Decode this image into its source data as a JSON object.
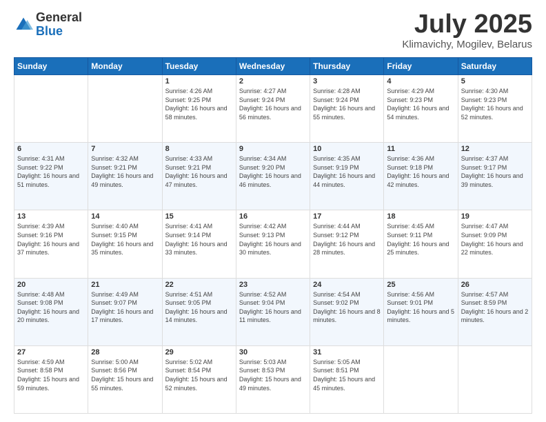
{
  "header": {
    "logo_general": "General",
    "logo_blue": "Blue",
    "title": "July 2025",
    "location": "Klimavichy, Mogilev, Belarus"
  },
  "weekdays": [
    "Sunday",
    "Monday",
    "Tuesday",
    "Wednesday",
    "Thursday",
    "Friday",
    "Saturday"
  ],
  "weeks": [
    [
      {
        "day": "",
        "sunrise": "",
        "sunset": "",
        "daylight": ""
      },
      {
        "day": "",
        "sunrise": "",
        "sunset": "",
        "daylight": ""
      },
      {
        "day": "1",
        "sunrise": "Sunrise: 4:26 AM",
        "sunset": "Sunset: 9:25 PM",
        "daylight": "Daylight: 16 hours and 58 minutes."
      },
      {
        "day": "2",
        "sunrise": "Sunrise: 4:27 AM",
        "sunset": "Sunset: 9:24 PM",
        "daylight": "Daylight: 16 hours and 56 minutes."
      },
      {
        "day": "3",
        "sunrise": "Sunrise: 4:28 AM",
        "sunset": "Sunset: 9:24 PM",
        "daylight": "Daylight: 16 hours and 55 minutes."
      },
      {
        "day": "4",
        "sunrise": "Sunrise: 4:29 AM",
        "sunset": "Sunset: 9:23 PM",
        "daylight": "Daylight: 16 hours and 54 minutes."
      },
      {
        "day": "5",
        "sunrise": "Sunrise: 4:30 AM",
        "sunset": "Sunset: 9:23 PM",
        "daylight": "Daylight: 16 hours and 52 minutes."
      }
    ],
    [
      {
        "day": "6",
        "sunrise": "Sunrise: 4:31 AM",
        "sunset": "Sunset: 9:22 PM",
        "daylight": "Daylight: 16 hours and 51 minutes."
      },
      {
        "day": "7",
        "sunrise": "Sunrise: 4:32 AM",
        "sunset": "Sunset: 9:21 PM",
        "daylight": "Daylight: 16 hours and 49 minutes."
      },
      {
        "day": "8",
        "sunrise": "Sunrise: 4:33 AM",
        "sunset": "Sunset: 9:21 PM",
        "daylight": "Daylight: 16 hours and 47 minutes."
      },
      {
        "day": "9",
        "sunrise": "Sunrise: 4:34 AM",
        "sunset": "Sunset: 9:20 PM",
        "daylight": "Daylight: 16 hours and 46 minutes."
      },
      {
        "day": "10",
        "sunrise": "Sunrise: 4:35 AM",
        "sunset": "Sunset: 9:19 PM",
        "daylight": "Daylight: 16 hours and 44 minutes."
      },
      {
        "day": "11",
        "sunrise": "Sunrise: 4:36 AM",
        "sunset": "Sunset: 9:18 PM",
        "daylight": "Daylight: 16 hours and 42 minutes."
      },
      {
        "day": "12",
        "sunrise": "Sunrise: 4:37 AM",
        "sunset": "Sunset: 9:17 PM",
        "daylight": "Daylight: 16 hours and 39 minutes."
      }
    ],
    [
      {
        "day": "13",
        "sunrise": "Sunrise: 4:39 AM",
        "sunset": "Sunset: 9:16 PM",
        "daylight": "Daylight: 16 hours and 37 minutes."
      },
      {
        "day": "14",
        "sunrise": "Sunrise: 4:40 AM",
        "sunset": "Sunset: 9:15 PM",
        "daylight": "Daylight: 16 hours and 35 minutes."
      },
      {
        "day": "15",
        "sunrise": "Sunrise: 4:41 AM",
        "sunset": "Sunset: 9:14 PM",
        "daylight": "Daylight: 16 hours and 33 minutes."
      },
      {
        "day": "16",
        "sunrise": "Sunrise: 4:42 AM",
        "sunset": "Sunset: 9:13 PM",
        "daylight": "Daylight: 16 hours and 30 minutes."
      },
      {
        "day": "17",
        "sunrise": "Sunrise: 4:44 AM",
        "sunset": "Sunset: 9:12 PM",
        "daylight": "Daylight: 16 hours and 28 minutes."
      },
      {
        "day": "18",
        "sunrise": "Sunrise: 4:45 AM",
        "sunset": "Sunset: 9:11 PM",
        "daylight": "Daylight: 16 hours and 25 minutes."
      },
      {
        "day": "19",
        "sunrise": "Sunrise: 4:47 AM",
        "sunset": "Sunset: 9:09 PM",
        "daylight": "Daylight: 16 hours and 22 minutes."
      }
    ],
    [
      {
        "day": "20",
        "sunrise": "Sunrise: 4:48 AM",
        "sunset": "Sunset: 9:08 PM",
        "daylight": "Daylight: 16 hours and 20 minutes."
      },
      {
        "day": "21",
        "sunrise": "Sunrise: 4:49 AM",
        "sunset": "Sunset: 9:07 PM",
        "daylight": "Daylight: 16 hours and 17 minutes."
      },
      {
        "day": "22",
        "sunrise": "Sunrise: 4:51 AM",
        "sunset": "Sunset: 9:05 PM",
        "daylight": "Daylight: 16 hours and 14 minutes."
      },
      {
        "day": "23",
        "sunrise": "Sunrise: 4:52 AM",
        "sunset": "Sunset: 9:04 PM",
        "daylight": "Daylight: 16 hours and 11 minutes."
      },
      {
        "day": "24",
        "sunrise": "Sunrise: 4:54 AM",
        "sunset": "Sunset: 9:02 PM",
        "daylight": "Daylight: 16 hours and 8 minutes."
      },
      {
        "day": "25",
        "sunrise": "Sunrise: 4:56 AM",
        "sunset": "Sunset: 9:01 PM",
        "daylight": "Daylight: 16 hours and 5 minutes."
      },
      {
        "day": "26",
        "sunrise": "Sunrise: 4:57 AM",
        "sunset": "Sunset: 8:59 PM",
        "daylight": "Daylight: 16 hours and 2 minutes."
      }
    ],
    [
      {
        "day": "27",
        "sunrise": "Sunrise: 4:59 AM",
        "sunset": "Sunset: 8:58 PM",
        "daylight": "Daylight: 15 hours and 59 minutes."
      },
      {
        "day": "28",
        "sunrise": "Sunrise: 5:00 AM",
        "sunset": "Sunset: 8:56 PM",
        "daylight": "Daylight: 15 hours and 55 minutes."
      },
      {
        "day": "29",
        "sunrise": "Sunrise: 5:02 AM",
        "sunset": "Sunset: 8:54 PM",
        "daylight": "Daylight: 15 hours and 52 minutes."
      },
      {
        "day": "30",
        "sunrise": "Sunrise: 5:03 AM",
        "sunset": "Sunset: 8:53 PM",
        "daylight": "Daylight: 15 hours and 49 minutes."
      },
      {
        "day": "31",
        "sunrise": "Sunrise: 5:05 AM",
        "sunset": "Sunset: 8:51 PM",
        "daylight": "Daylight: 15 hours and 45 minutes."
      },
      {
        "day": "",
        "sunrise": "",
        "sunset": "",
        "daylight": ""
      },
      {
        "day": "",
        "sunrise": "",
        "sunset": "",
        "daylight": ""
      }
    ]
  ]
}
